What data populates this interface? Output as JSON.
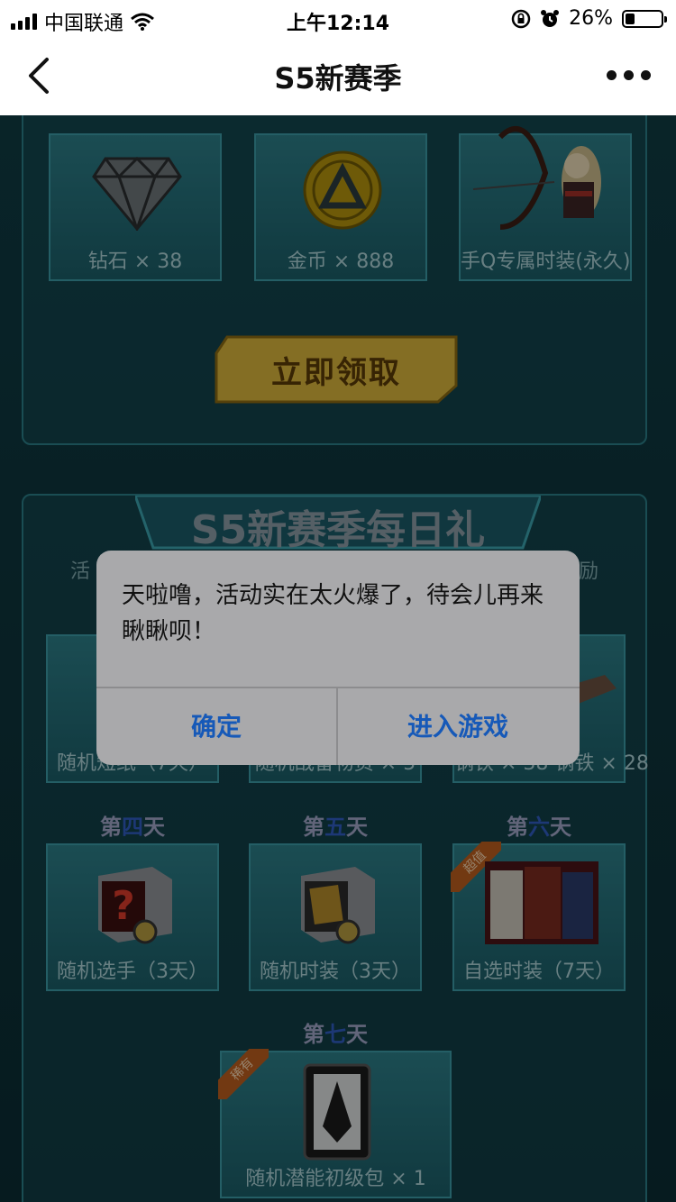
{
  "status_bar": {
    "carrier": "中国联通",
    "time": "上午12:14",
    "battery_percent": "26%",
    "battery_level": 0.26
  },
  "nav": {
    "title": "S5新赛季"
  },
  "top_rewards": [
    {
      "caption": "钻石 × 38",
      "icon": "diamond-icon"
    },
    {
      "caption": "金币 × 888",
      "icon": "coin-icon"
    },
    {
      "caption": "手Q专属时装(永久)",
      "icon": "archer-costume-icon"
    }
  ],
  "claim_button": "立即领取",
  "daily_section": {
    "banner": "S5新赛季每日礼",
    "left_text": "活",
    "right_text": "励",
    "row2_captions": [
      "随机短纸（7天）",
      "随机战备物资 × 5",
      "钢铁 × 38  钢铁 × 28"
    ],
    "days": [
      {
        "label_a": "第",
        "label_b": "四",
        "label_c": "天",
        "caption": "随机选手（3天）"
      },
      {
        "label_a": "第",
        "label_b": "五",
        "label_c": "天",
        "caption": "随机时装（3天）"
      },
      {
        "label_a": "第",
        "label_b": "六",
        "label_c": "天",
        "caption": "自选时装（7天）",
        "badge": "超值"
      },
      {
        "label_a": "第",
        "label_b": "七",
        "label_c": "天",
        "caption": "随机潜能初级包 × 1",
        "badge": "稀有"
      }
    ]
  },
  "dialog": {
    "message": "天啦噜，活动实在太火爆了，待会儿再来瞅瞅呗！",
    "confirm": "确定",
    "enter_game": "进入游戏"
  },
  "colors": {
    "accent_blue": "#1659b8",
    "claim_gold": "#d6b23a",
    "panel_teal": "#2c7c86"
  }
}
